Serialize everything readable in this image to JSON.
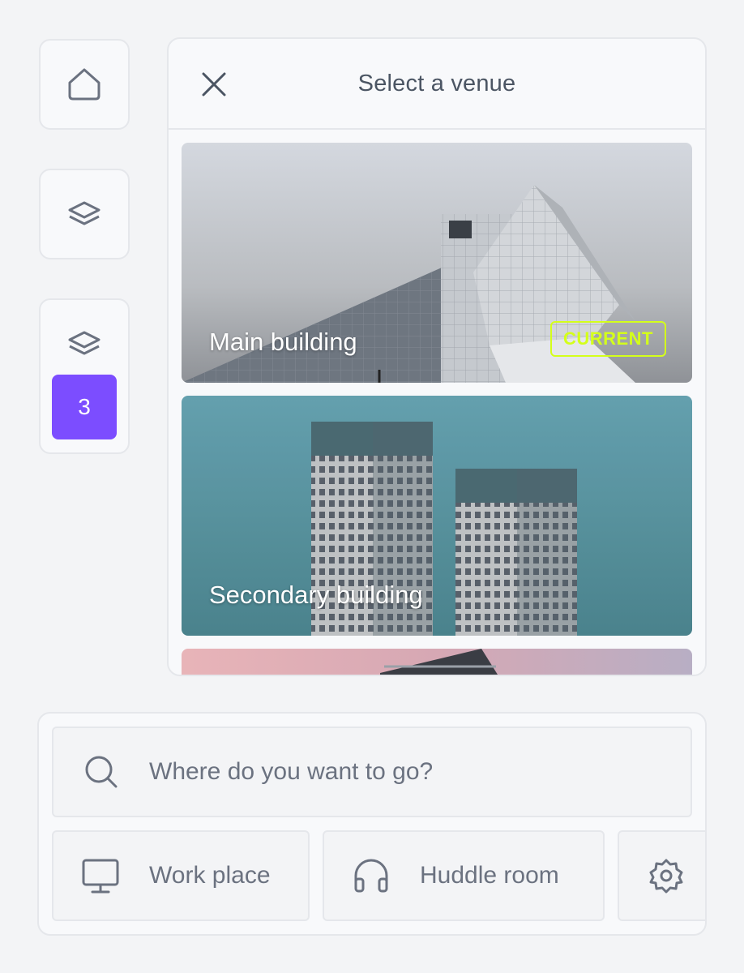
{
  "sidebar": {
    "home_icon": "home-icon",
    "layers_icon": "layers-icon",
    "floor_badge": "3"
  },
  "venue_panel": {
    "title": "Select a venue",
    "close_icon": "close-icon",
    "venues": [
      {
        "name": "Main building",
        "badge": "CURRENT"
      },
      {
        "name": "Secondary building",
        "badge": ""
      },
      {
        "name": "",
        "badge": ""
      }
    ]
  },
  "search": {
    "placeholder": "Where do you want to go?",
    "icon": "search-icon"
  },
  "quick_filters": [
    {
      "label": "Work place",
      "icon": "monitor-icon"
    },
    {
      "label": "Huddle room",
      "icon": "headphones-icon"
    },
    {
      "label": "",
      "icon": "gear-icon"
    }
  ],
  "colors": {
    "accent": "#7c4dff",
    "current_badge": "#d4ff1a",
    "background": "#f3f4f6"
  }
}
